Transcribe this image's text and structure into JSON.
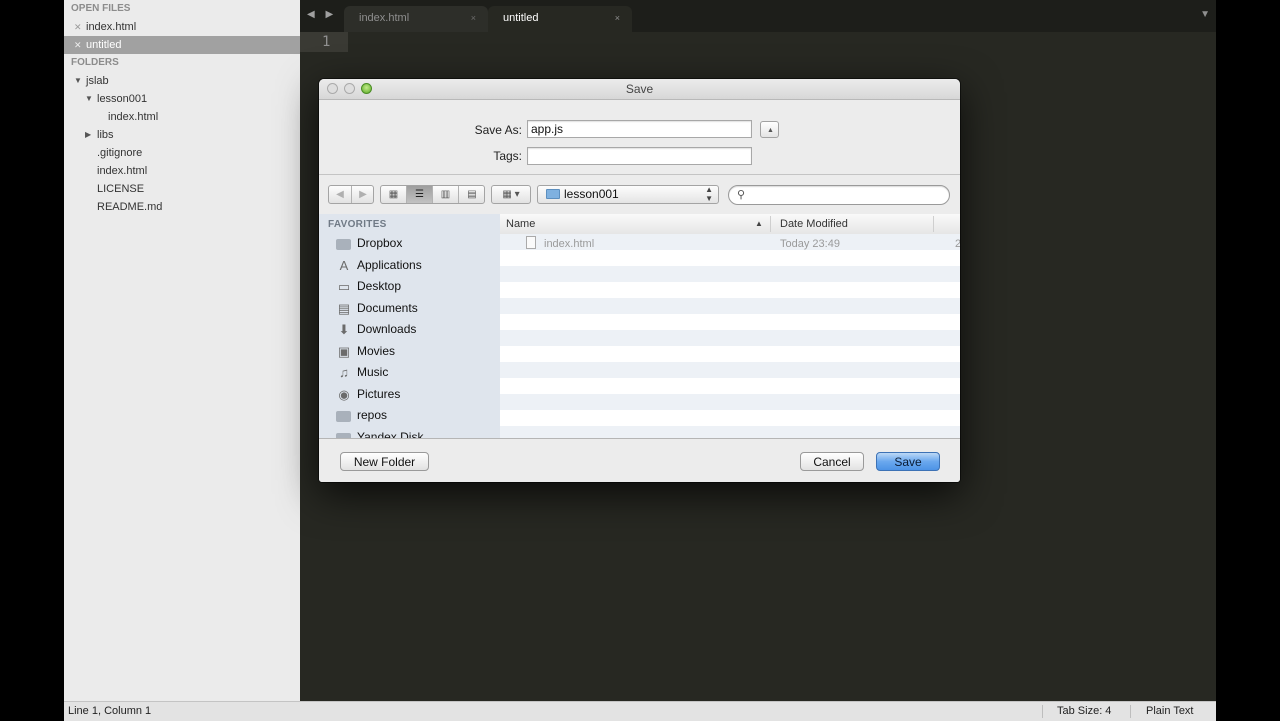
{
  "sidebar": {
    "open_files_header": "OPEN FILES",
    "open_files": [
      {
        "name": "index.html",
        "selected": false
      },
      {
        "name": "untitled",
        "selected": true
      }
    ],
    "folders_header": "FOLDERS",
    "tree": [
      {
        "name": "jslab",
        "expanded": true
      },
      {
        "name": "lesson001",
        "expanded": true
      },
      {
        "name": "index.html"
      },
      {
        "name": "libs",
        "expanded": false
      },
      {
        "name": ".gitignore"
      },
      {
        "name": "index.html"
      },
      {
        "name": "LICENSE"
      },
      {
        "name": "README.md"
      }
    ]
  },
  "editor": {
    "nav_arrows": "◀ ▶",
    "tabs": [
      {
        "label": "index.html",
        "close": "×",
        "active": false
      },
      {
        "label": "untitled",
        "close": "×",
        "active": true
      }
    ],
    "tab_dropdown": "▼",
    "line_number": "1",
    "background": "#272822"
  },
  "status_bar": {
    "position": "Line 1, Column 1",
    "tab_size": "Tab Size: 4",
    "syntax": "Plain Text"
  },
  "save_dialog": {
    "title": "Save",
    "save_as_label": "Save As:",
    "save_as_value": "app.js",
    "tags_label": "Tags:",
    "tags_value": "",
    "expand_button": "▲",
    "back_button": "◀",
    "forward_button": "▶",
    "view_modes": [
      {
        "name": "icon-view",
        "glyph": "▦",
        "active": false
      },
      {
        "name": "list-view",
        "glyph": "☰",
        "active": true
      },
      {
        "name": "column-view",
        "glyph": "▥",
        "active": false
      },
      {
        "name": "coverflow-view",
        "glyph": "▤",
        "active": false
      }
    ],
    "arrange_button": "▦ ▾",
    "location": "lesson001",
    "search_placeholder": "",
    "favorites_header": "FAVORITES",
    "favorites": [
      {
        "label": "Dropbox",
        "icon": "dropbox-icon",
        "glyph": ""
      },
      {
        "label": "Applications",
        "icon": "applications-icon",
        "glyph": "A"
      },
      {
        "label": "Desktop",
        "icon": "desktop-icon",
        "glyph": "▭"
      },
      {
        "label": "Documents",
        "icon": "documents-icon",
        "glyph": "▤"
      },
      {
        "label": "Downloads",
        "icon": "downloads-icon",
        "glyph": "⬇"
      },
      {
        "label": "Movies",
        "icon": "movies-icon",
        "glyph": "▣"
      },
      {
        "label": "Music",
        "icon": "music-icon",
        "glyph": "♫"
      },
      {
        "label": "Pictures",
        "icon": "pictures-icon",
        "glyph": "◉"
      },
      {
        "label": "repos",
        "icon": "folder-icon",
        "glyph": ""
      },
      {
        "label": "Yandex.Disk",
        "icon": "folder-icon",
        "glyph": ""
      }
    ],
    "columns": {
      "name": "Name",
      "date_modified": "Date Modified"
    },
    "sort_indicator": "▲",
    "files": [
      {
        "name": "index.html",
        "date_modified": "Today 23:49",
        "extra": "2"
      }
    ],
    "new_folder_button": "New Folder",
    "cancel_button": "Cancel",
    "save_button": "Save",
    "accent_color": "#4d93e6"
  }
}
